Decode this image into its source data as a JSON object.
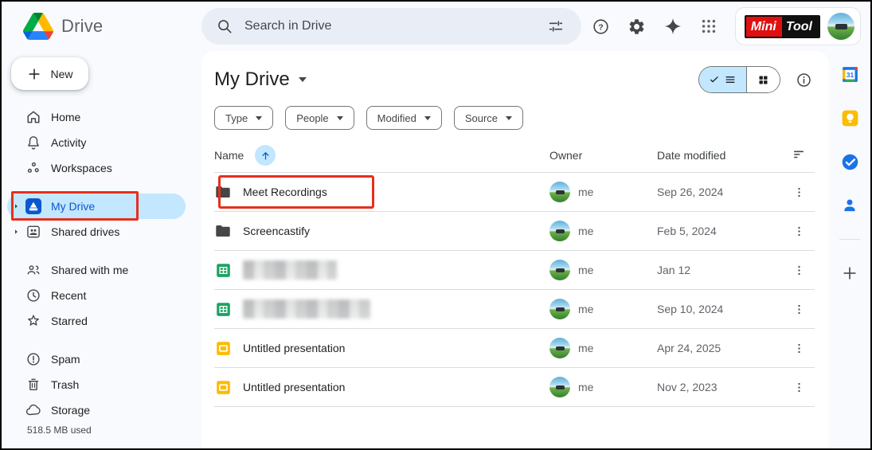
{
  "app": {
    "name": "Drive"
  },
  "topbar": {
    "search_placeholder": "Search in Drive",
    "account": {
      "brand_mini": "Mini",
      "brand_tool": "Tool"
    }
  },
  "sidebar": {
    "new_button_label": "New",
    "sections": [
      {
        "items": [
          {
            "label": "Home"
          },
          {
            "label": "Activity"
          },
          {
            "label": "Workspaces"
          }
        ]
      },
      {
        "items": [
          {
            "label": "My Drive",
            "selected": true,
            "expandable": true
          },
          {
            "label": "Shared drives",
            "expandable": true
          }
        ]
      },
      {
        "items": [
          {
            "label": "Shared with me"
          },
          {
            "label": "Recent"
          },
          {
            "label": "Starred"
          }
        ]
      },
      {
        "items": [
          {
            "label": "Spam"
          },
          {
            "label": "Trash"
          },
          {
            "label": "Storage"
          }
        ]
      }
    ],
    "storage_used": "518.5 MB used"
  },
  "main": {
    "title": "My Drive",
    "filters": [
      {
        "label": "Type"
      },
      {
        "label": "People"
      },
      {
        "label": "Modified"
      },
      {
        "label": "Source"
      }
    ],
    "table": {
      "columns": {
        "name": "Name",
        "owner": "Owner",
        "date_modified": "Date modified"
      },
      "rows": [
        {
          "name": "Meet Recordings",
          "type": "folder",
          "owner": "me",
          "date": "Sep 26, 2024",
          "annotated": true
        },
        {
          "name": "Screencastify",
          "type": "folder",
          "owner": "me",
          "date": "Feb 5, 2024"
        },
        {
          "name": "",
          "type": "spreadsheet",
          "owner": "me",
          "date": "Jan 12",
          "redacted": true
        },
        {
          "name": "",
          "type": "spreadsheet",
          "owner": "me",
          "date": "Sep 10, 2024",
          "redacted": true
        },
        {
          "name": "Untitled presentation",
          "type": "presentation",
          "owner": "me",
          "date": "Apr 24, 2025"
        },
        {
          "name": "Untitled presentation",
          "type": "presentation",
          "owner": "me",
          "date": "Nov 2, 2023"
        }
      ]
    }
  },
  "side_panel": {
    "calendar_label": "31"
  },
  "annotations": {
    "highlight_color": "#e5301d",
    "targets": [
      "sidebar-my-drive",
      "row-meet-recordings"
    ]
  },
  "colors": {
    "background": "#f8fafd",
    "card": "#ffffff",
    "search_bar": "#e9eef6",
    "selected_pill": "#c2e7ff",
    "selected_text": "#0b57d0",
    "icon_grey": "#444746"
  }
}
